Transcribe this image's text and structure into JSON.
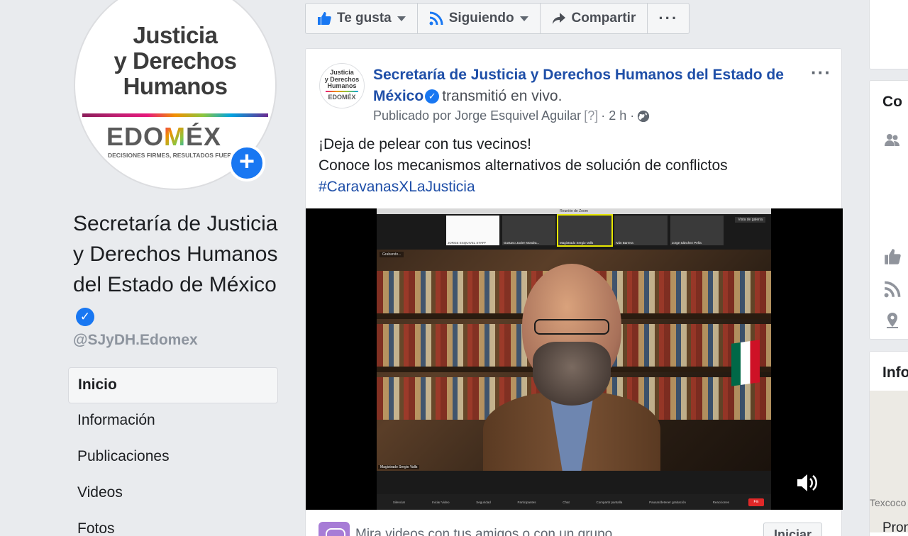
{
  "profile": {
    "logo_line1": "Justicia",
    "logo_line2": "y Derechos",
    "logo_line3": "Humanos",
    "logo_brand_pre": "EDO",
    "logo_brand_m": "M",
    "logo_brand_post": "ÉX",
    "logo_tagline": "DECISIONES FIRMES, RESULTADOS FUERTES",
    "add_glyph": "+",
    "page_name": "Secretaría de Justicia y Derechos Humanos del Estado de México",
    "verified_glyph": "✓",
    "handle": "@SJyDH.Edomex"
  },
  "nav": {
    "items": [
      {
        "label": "Inicio",
        "active": true
      },
      {
        "label": "Información"
      },
      {
        "label": "Publicaciones"
      },
      {
        "label": "Videos"
      },
      {
        "label": "Fotos"
      }
    ]
  },
  "actionbar": {
    "like_label": "Te gusta",
    "follow_label": "Siguiendo",
    "share_label": "Compartir",
    "more_label": "···"
  },
  "post": {
    "avatar_line1": "Justicia",
    "avatar_line2": "y Derechos",
    "avatar_line3": "Humanos",
    "avatar_brand": "EDOMÉX",
    "author": "Secretaría de Justicia y Derechos Humanos del Estado de México",
    "action": "transmitió en vivo.",
    "published_by": "Publicado por Jorge Esquivel Aguilar",
    "unknown_marker": "[?]",
    "time": "· 2 h ·",
    "more_label": "···",
    "line1": "¡Deja de pelear con tus vecinos!",
    "line2": "Conoce los mecanismos alternativos de solución de conflictos",
    "hashtag": "#CaravanasXLaJusticia"
  },
  "video": {
    "window_title": "Reunión de Zoom",
    "view_button": "Vista de galería",
    "top_control": "Grabando...",
    "thumbnails": [
      {
        "name": "JORGE ESQUIVEL STAFF",
        "white": true
      },
      {
        "name": "Gustavo Javier Mondra..."
      },
      {
        "name": "Magistrado Sergio Valls",
        "selected": true
      },
      {
        "name": "Iván Barrera"
      },
      {
        "name": "Jorge Sánchez Peña"
      }
    ],
    "speaker_tag": "Magistrado Sergio Valls",
    "toolbar": [
      "Silenciar",
      "Iniciar Video",
      "Seguridad",
      "Participantes",
      "Chat",
      "Compartir pantalla",
      "Pausar/detener grabación",
      "Reacciones"
    ],
    "end_label": "Fin"
  },
  "share": {
    "text": "Mira videos con tus amigos o con un grupo",
    "button": "Iniciar"
  },
  "right": {
    "card1_title": "Co",
    "card2_title": "Info",
    "map_label": "Texcoco",
    "bottom_text": "Pron"
  },
  "colors": {
    "brand_blue": "#1877f2",
    "link_blue": "#1f4fa8",
    "page_bg": "#e9ebee"
  }
}
